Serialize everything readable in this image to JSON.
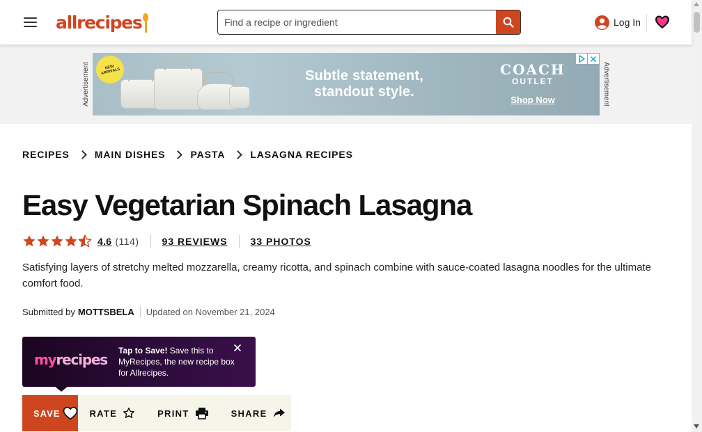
{
  "header": {
    "logo_text": "allrecipes",
    "search_placeholder": "Find a recipe or ingredient",
    "login_label": "Log In"
  },
  "ad": {
    "label": "Advertisement",
    "badge": "NEW ARRIVALS",
    "headline_line1": "Subtle statement,",
    "headline_line2": "standout style.",
    "brand": "COACH",
    "brand_sub": "OUTLET",
    "cta": "Shop Now",
    "background": "#a9bfc8"
  },
  "breadcrumb": [
    "RECIPES",
    "MAIN DISHES",
    "PASTA",
    "LASAGNA RECIPES"
  ],
  "recipe": {
    "title": "Easy Vegetarian Spinach Lasagna",
    "rating_value": "4.6",
    "rating_count": "(114)",
    "stars": 4.5,
    "reviews_link": "93 REVIEWS",
    "photos_link": "33 PHOTOS",
    "description": "Satisfying layers of stretchy melted mozzarella, creamy ricotta, and spinach combine with sauce-coated lasagna noodles for the ultimate comfort food.",
    "submitted_prefix": "Submitted by",
    "author": "MOTTSBELA",
    "updated": "Updated on November 21, 2024"
  },
  "tooltip": {
    "logo_my": "my",
    "logo_rest": "recipes",
    "bold": "Tap to Save!",
    "text": " Save this to MyRecipes, the new recipe box for Allrecipes."
  },
  "actions": {
    "save": "SAVE",
    "rate": "RATE",
    "print": "PRINT",
    "share": "SHARE"
  },
  "colors": {
    "brand": "#ce4620",
    "star": "#ce4620",
    "heart": "#f53b8b",
    "action_bar": "#f5f5e9"
  },
  "icons": [
    "hamburger-icon",
    "search-icon",
    "user-icon",
    "heart-icon",
    "star-icon",
    "printer-icon",
    "share-icon",
    "close-icon",
    "adchoices-icon"
  ]
}
